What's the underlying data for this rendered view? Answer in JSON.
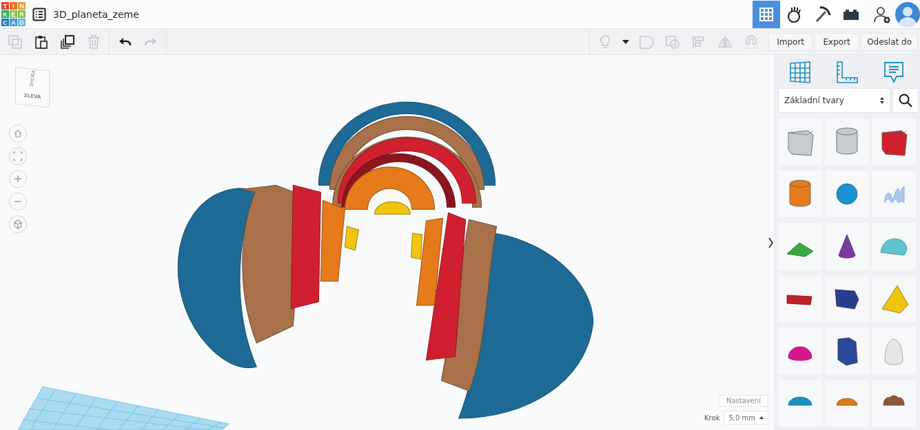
{
  "logo": {
    "letters": [
      {
        "char": "T",
        "color": "#e8442b"
      },
      {
        "char": "I",
        "color": "#f26a2e"
      },
      {
        "char": "N",
        "color": "#f39c34"
      },
      {
        "char": "K",
        "color": "#2fa957"
      },
      {
        "char": "E",
        "color": "#8cc63f"
      },
      {
        "char": "R",
        "color": "#7dc242"
      },
      {
        "char": "C",
        "color": "#1a7ac1"
      },
      {
        "char": "A",
        "color": "#3d9ad8"
      },
      {
        "char": "D",
        "color": "#6ab4e2"
      }
    ]
  },
  "project": {
    "title": "3D_planeta_zeme"
  },
  "nav_tabs": [
    {
      "kind": "grid",
      "selected": true
    },
    {
      "kind": "hand",
      "selected": false
    },
    {
      "kind": "pickaxe",
      "selected": false
    },
    {
      "kind": "brick",
      "selected": false
    }
  ],
  "edit_tools": [
    {
      "kind": "copy",
      "disabled": true
    },
    {
      "kind": "paste",
      "disabled": false
    },
    {
      "kind": "duplicate",
      "disabled": false
    },
    {
      "kind": "delete",
      "disabled": true
    }
  ],
  "history_tools": [
    {
      "kind": "undo",
      "disabled": false
    },
    {
      "kind": "redo",
      "disabled": true
    }
  ],
  "view_tools": [
    {
      "kind": "bulb",
      "disabled": true
    },
    {
      "kind": "dropdown",
      "disabled": false
    },
    {
      "kind": "group",
      "disabled": true
    },
    {
      "kind": "ungroup",
      "disabled": true
    },
    {
      "kind": "align",
      "disabled": true
    },
    {
      "kind": "mirror",
      "disabled": true
    },
    {
      "kind": "magnet",
      "disabled": true
    }
  ],
  "actions": [
    "Import",
    "Export",
    "Odeslat do"
  ],
  "view_cube": {
    "top": "SHORA",
    "front": "ZLEVA"
  },
  "view_controls": [
    {
      "kind": "home"
    },
    {
      "kind": "fit"
    },
    {
      "kind": "zoom-in"
    },
    {
      "kind": "zoom-out"
    },
    {
      "kind": "perspective"
    }
  ],
  "settings": {
    "button": "Nastavení",
    "step_label": "Krok",
    "step_value": "5,0 mm"
  },
  "shape_library": {
    "category": "Základní tvary",
    "shapes": [
      {
        "kind": "box",
        "color": "#c8cbd2"
      },
      {
        "kind": "cylinder",
        "color": "#c8cbd2"
      },
      {
        "kind": "box",
        "color": "#d0202f"
      },
      {
        "kind": "cylinder",
        "color": "#e77a1a"
      },
      {
        "kind": "sphere",
        "color": "#1a93cf"
      },
      {
        "kind": "scribble",
        "color": "#a9c9ea"
      },
      {
        "kind": "roof",
        "color": "#3aa844"
      },
      {
        "kind": "cone",
        "color": "#7b3aa0"
      },
      {
        "kind": "round-roof",
        "color": "#5fc4cf"
      },
      {
        "kind": "text",
        "color": "#c0202a"
      },
      {
        "kind": "prism",
        "color": "#283f8f"
      },
      {
        "kind": "pyramid",
        "color": "#f1c40f"
      },
      {
        "kind": "half-sphere",
        "color": "#d8168c"
      },
      {
        "kind": "polygon",
        "color": "#2d4a9a"
      },
      {
        "kind": "paraboloid",
        "color": "#e6e6e6"
      },
      {
        "kind": "torus",
        "color": "#1a8fc4"
      },
      {
        "kind": "tube",
        "color": "#e07a1a"
      },
      {
        "kind": "heart",
        "color": "#8a5a3a"
      }
    ]
  }
}
